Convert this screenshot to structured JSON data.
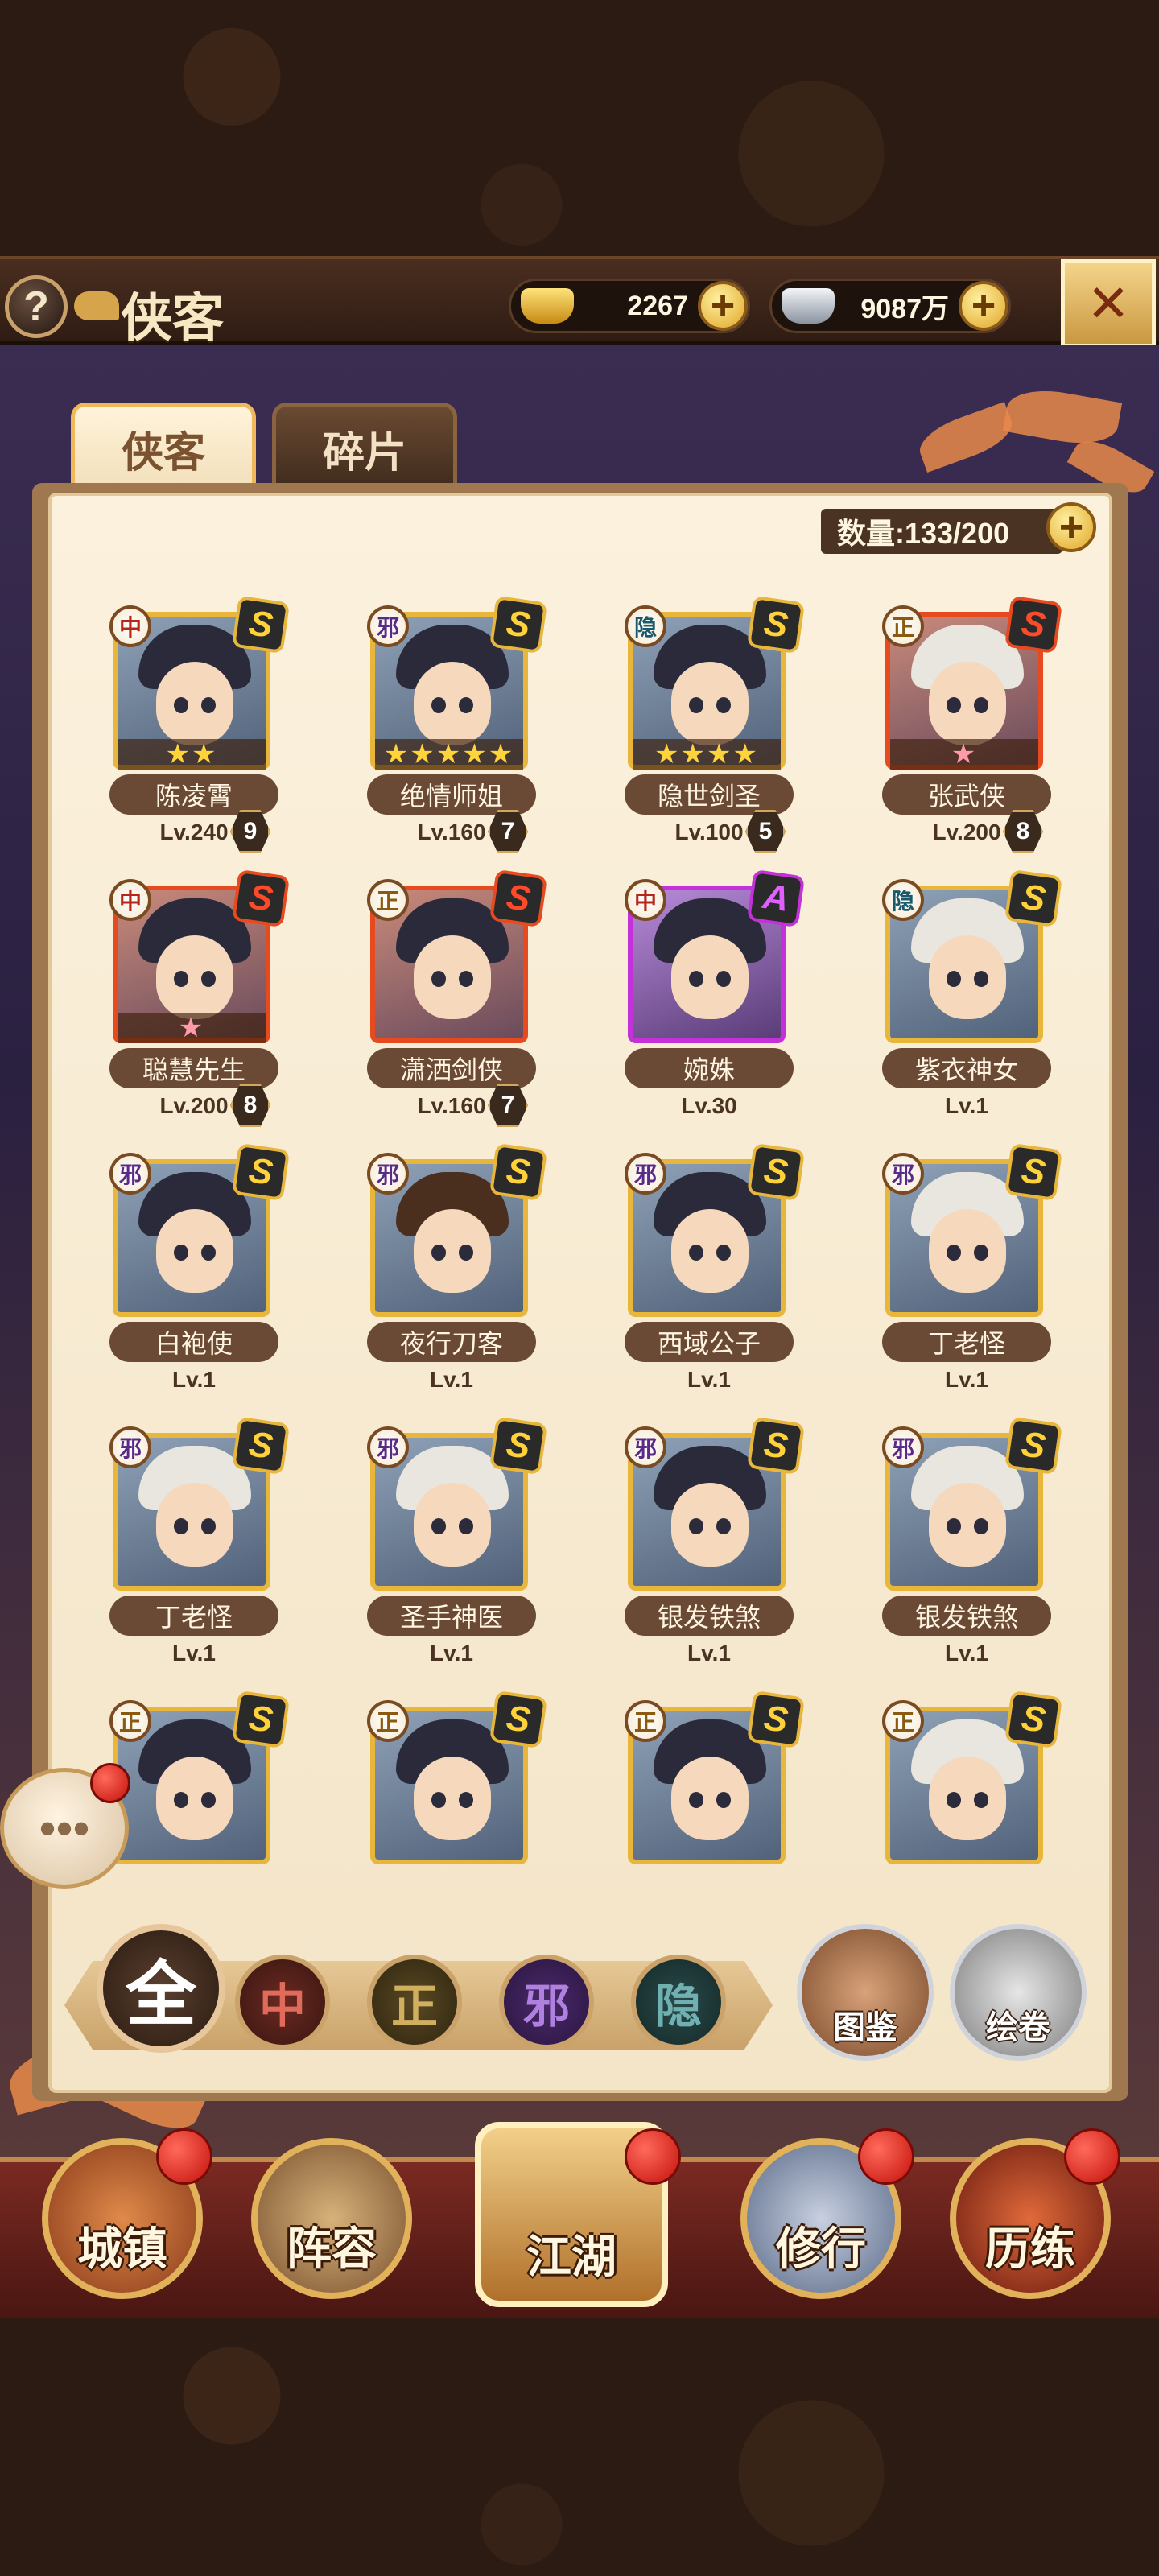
{
  "header": {
    "title": "侠客",
    "help_label": "?",
    "gold_amount": "2267",
    "silver_amount": "9087万",
    "plus_label": "+"
  },
  "tabs": [
    {
      "label": "侠客",
      "active": true
    },
    {
      "label": "碎片",
      "active": false
    }
  ],
  "count_label": "数量:133/200",
  "heroes": [
    {
      "faction": "中",
      "grade": "S",
      "name": "陈凌霄",
      "level": "Lv.240",
      "badge": "9",
      "stars": "★★",
      "frame": "gold"
    },
    {
      "faction": "邪",
      "grade": "S",
      "name": "绝情师姐",
      "level": "Lv.160",
      "badge": "7",
      "stars": "★★★★★",
      "frame": "gold"
    },
    {
      "faction": "隐",
      "grade": "S",
      "name": "隐世剑圣",
      "level": "Lv.100",
      "badge": "5",
      "stars": "★★★★",
      "frame": "gold"
    },
    {
      "faction": "正",
      "grade": "S",
      "name": "张武侠",
      "level": "Lv.200",
      "badge": "8",
      "stars": "★",
      "frame": "red"
    },
    {
      "faction": "中",
      "grade": "S",
      "name": "聪慧先生",
      "level": "Lv.200",
      "badge": "8",
      "stars": "★",
      "frame": "red"
    },
    {
      "faction": "正",
      "grade": "S",
      "name": "潇洒剑侠",
      "level": "Lv.160",
      "badge": "7",
      "stars": "",
      "frame": "red"
    },
    {
      "faction": "中",
      "grade": "A",
      "name": "婉姝",
      "level": "Lv.30",
      "badge": "",
      "stars": "",
      "frame": "purple"
    },
    {
      "faction": "隐",
      "grade": "S",
      "name": "紫衣神女",
      "level": "Lv.1",
      "badge": "",
      "stars": "",
      "frame": "gold"
    },
    {
      "faction": "邪",
      "grade": "S",
      "name": "白袍使",
      "level": "Lv.1",
      "badge": "",
      "stars": "",
      "frame": "gold"
    },
    {
      "faction": "邪",
      "grade": "S",
      "name": "夜行刀客",
      "level": "Lv.1",
      "badge": "",
      "stars": "",
      "frame": "gold"
    },
    {
      "faction": "邪",
      "grade": "S",
      "name": "西域公子",
      "level": "Lv.1",
      "badge": "",
      "stars": "",
      "frame": "gold"
    },
    {
      "faction": "邪",
      "grade": "S",
      "name": "丁老怪",
      "level": "Lv.1",
      "badge": "",
      "stars": "",
      "frame": "gold"
    },
    {
      "faction": "邪",
      "grade": "S",
      "name": "丁老怪",
      "level": "Lv.1",
      "badge": "",
      "stars": "",
      "frame": "gold"
    },
    {
      "faction": "邪",
      "grade": "S",
      "name": "圣手神医",
      "level": "Lv.1",
      "badge": "",
      "stars": "",
      "frame": "gold"
    },
    {
      "faction": "邪",
      "grade": "S",
      "name": "银发铁煞",
      "level": "Lv.1",
      "badge": "",
      "stars": "",
      "frame": "gold"
    },
    {
      "faction": "邪",
      "grade": "S",
      "name": "银发铁煞",
      "level": "Lv.1",
      "badge": "",
      "stars": "",
      "frame": "gold"
    },
    {
      "faction": "正",
      "grade": "S",
      "name": "",
      "level": "",
      "badge": "",
      "stars": "",
      "frame": "gold"
    },
    {
      "faction": "正",
      "grade": "S",
      "name": "",
      "level": "",
      "badge": "",
      "stars": "",
      "frame": "gold"
    },
    {
      "faction": "正",
      "grade": "S",
      "name": "",
      "level": "",
      "badge": "",
      "stars": "",
      "frame": "gold"
    },
    {
      "faction": "正",
      "grade": "S",
      "name": "",
      "level": "",
      "badge": "",
      "stars": "",
      "frame": "gold"
    }
  ],
  "filters": {
    "all": "全",
    "zhong": "中",
    "zheng": "正",
    "xie": "邪",
    "yin": "隐"
  },
  "side_buttons": {
    "tujian": "图鉴",
    "huijuan": "绘卷"
  },
  "chat_icon": "chat-bubble-icon",
  "nav": [
    {
      "label": "城镇"
    },
    {
      "label": "阵容"
    },
    {
      "label": "江湖"
    },
    {
      "label": "修行"
    },
    {
      "label": "历练"
    }
  ]
}
